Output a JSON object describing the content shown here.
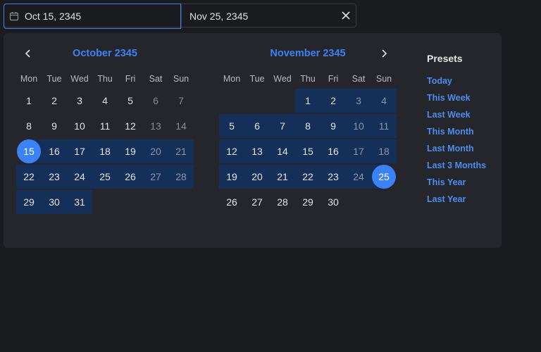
{
  "inputs": {
    "start_value": "Oct 15, 2345",
    "end_value": "Nov 25, 2345"
  },
  "weekdays": [
    "Mon",
    "Tue",
    "Wed",
    "Thu",
    "Fri",
    "Sat",
    "Sun"
  ],
  "months": [
    {
      "title": "October 2345",
      "first_weekday_index": 0,
      "days_in_month": 31,
      "range_from": 15,
      "range_to": 31,
      "range_start_edge": 15,
      "range_end_edge": null
    },
    {
      "title": "November 2345",
      "first_weekday_index": 3,
      "days_in_month": 30,
      "range_from": 1,
      "range_to": 25,
      "range_start_edge": null,
      "range_end_edge": 25
    }
  ],
  "presets": {
    "title": "Presets",
    "items": [
      "Today",
      "This Week",
      "Last Week",
      "This Month",
      "Last Month",
      "Last 3 Months",
      "This Year",
      "Last Year"
    ]
  },
  "colors": {
    "accent": "#3b82f6",
    "range_bg": "#143059",
    "panel_bg": "#25262b",
    "page_bg": "#1a1b1e"
  },
  "icons": {
    "calendar": "calendar-icon",
    "clear": "close-icon",
    "prev": "chevron-left-icon",
    "next": "chevron-right-icon"
  }
}
